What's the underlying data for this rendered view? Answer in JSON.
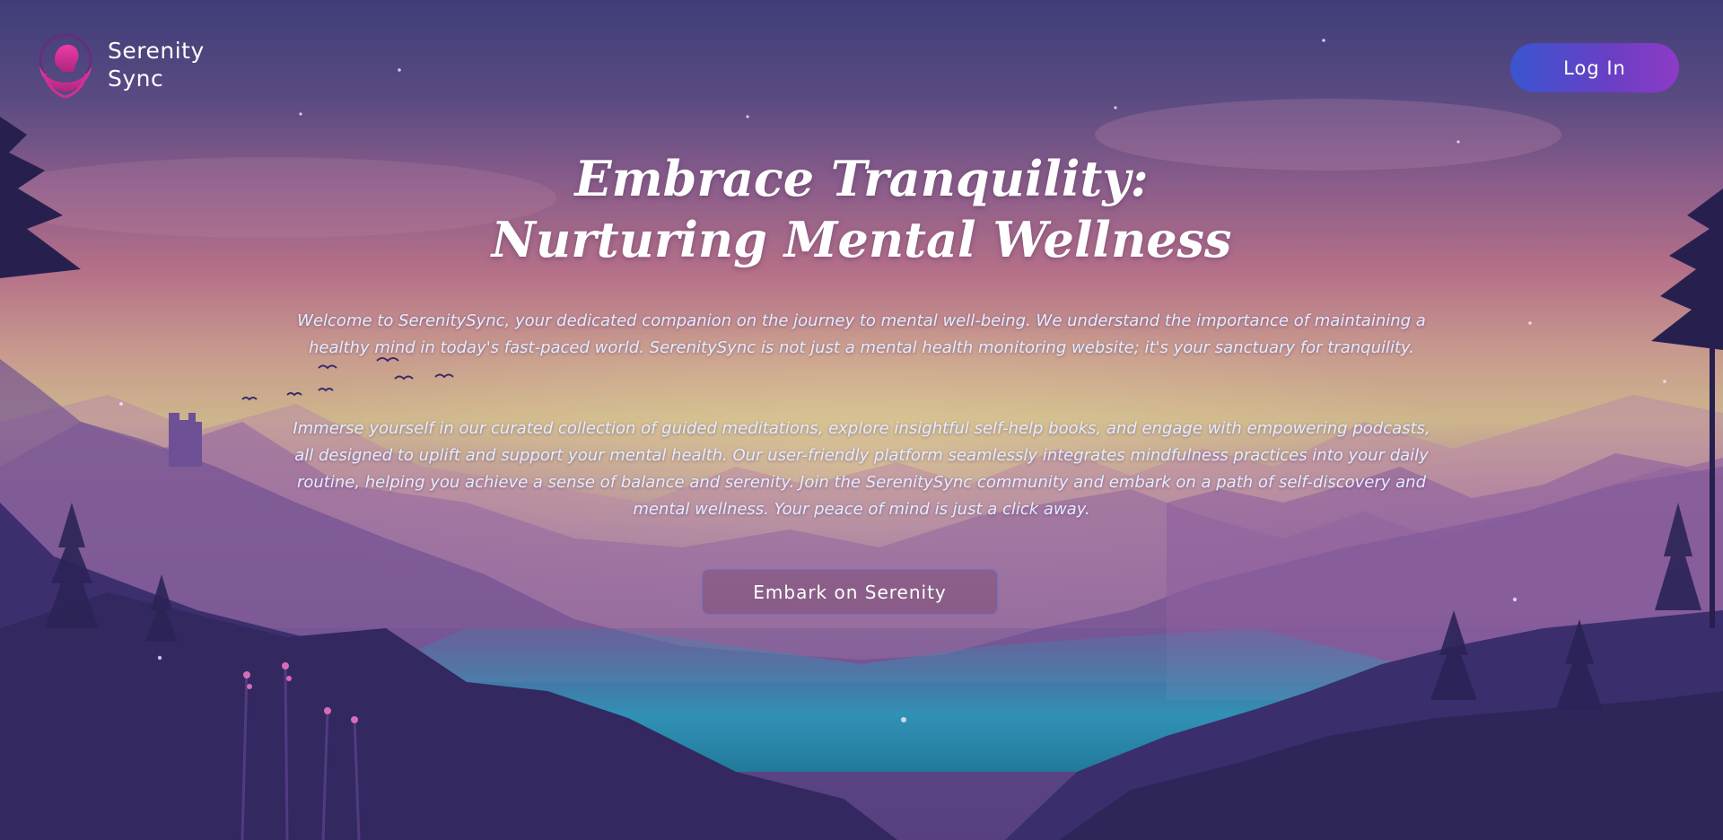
{
  "header": {
    "brand_line1": "Serenity",
    "brand_line2": "Sync",
    "login_label": "Log In"
  },
  "hero": {
    "title_line1": "Embrace Tranquility:",
    "title_line2": "Nurturing Mental Wellness",
    "paragraph1": "Welcome to SerenitySync, your dedicated companion on the journey to mental well-being. We understand the importance of maintaining a healthy mind in today's fast-paced world. SerenitySync is not just a mental health monitoring website; it's your sanctuary for tranquility.",
    "paragraph2": "Immerse yourself in our curated collection of guided meditations, explore insightful self-help books, and engage with empowering podcasts, all designed to uplift and support your mental health. Our user-friendly platform seamlessly integrates mindfulness practices into your daily routine, helping you achieve a sense of balance and serenity. Join the SerenitySync community and embark on a path of self-discovery and mental wellness. Your peace of mind is just a click away.",
    "cta_label": "Embark on Serenity"
  },
  "icons": {
    "logo": "head-in-hands-logo-icon"
  },
  "colors": {
    "login_gradient_start": "#3a55d0",
    "login_gradient_end": "#8e3bc6",
    "cta_border": "#6b73c7",
    "logo_pink": "#d6359a",
    "text_light": "#e4ecff"
  }
}
